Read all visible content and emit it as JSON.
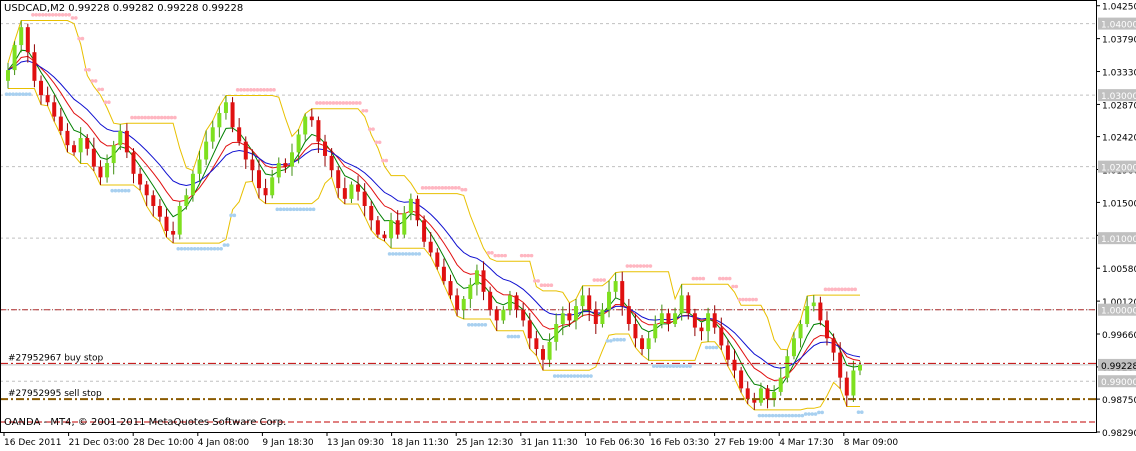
{
  "window": {
    "symbol_header": "USDCAD,M2  0.99228 0.99282 0.99228 0.99228",
    "broker_footer": "OANDA - MT4, © 2001-2011 MetaQuotes Software Corp."
  },
  "colors": {
    "background": "#ffffff",
    "grid": "#c0c0c0",
    "bull_candle": "#7ee01f",
    "bear_candle": "#e01010",
    "ma_fast": "#008000",
    "ma_mid": "#e01010",
    "ma_slow": "#1010d0",
    "channel": "#e8c000",
    "stop_upper_dots": "#ffb6c1",
    "stop_lower_dots": "#a8d0f0",
    "level_box": "#c0c0c0",
    "current_price_box": "#c0c0c0"
  },
  "chart_data": {
    "type": "candlestick",
    "ylim": [
      0.9829,
      1.0433
    ],
    "price_axis_ticks": [
      "1.04250",
      "1.03790",
      "1.03330",
      "1.02870",
      "1.02420",
      "1.01960",
      "1.01500",
      "1.01040",
      "1.00580",
      "1.00120",
      "0.99660",
      "0.99200",
      "0.98750",
      "0.98290"
    ],
    "level_labels": [
      {
        "value": 1.04,
        "text": "1.04000"
      },
      {
        "value": 1.03,
        "text": "1.03000"
      },
      {
        "value": 1.02,
        "text": "1.02000"
      },
      {
        "value": 1.01,
        "text": "1.01000"
      },
      {
        "value": 1.0,
        "text": "1.00000"
      },
      {
        "value": 0.99,
        "text": "0.99000"
      }
    ],
    "current_price": {
      "value": 0.99228,
      "text": "0.99228"
    },
    "time_axis_labels": [
      "16 Dec 2011",
      "21 Dec 03:00",
      "28 Dec 10:00",
      "4 Jan 08:00",
      "9 Jan 18:30",
      "13 Jan 09:30",
      "18 Jan 11:30",
      "25 Jan 12:30",
      "31 Jan 11:30",
      "10 Feb 06:30",
      "16 Feb 03:30",
      "27 Feb 19:00",
      "4 Mar 17:30",
      "8 Mar 09:00"
    ],
    "pending_orders": [
      {
        "label": "#27952967 buy stop",
        "price": 0.9925
      },
      {
        "label": "#27952995 sell stop",
        "price": 0.9875
      }
    ],
    "closes": [
      1.0335,
      1.037,
      1.0395,
      1.036,
      1.032,
      1.03,
      1.029,
      1.027,
      1.025,
      1.023,
      1.022,
      1.024,
      1.0225,
      1.02,
      1.0185,
      1.0205,
      1.023,
      1.025,
      1.022,
      1.019,
      1.0175,
      1.016,
      1.0145,
      1.013,
      1.011,
      1.0105,
      1.0145,
      1.016,
      1.019,
      1.021,
      1.0235,
      1.0255,
      1.0275,
      1.029,
      1.0255,
      1.0235,
      1.021,
      1.0195,
      1.017,
      1.016,
      1.0185,
      1.0205,
      1.02,
      1.022,
      1.0245,
      1.027,
      1.0265,
      1.0235,
      1.0215,
      1.0195,
      1.017,
      1.0155,
      1.0175,
      1.0165,
      1.0145,
      1.0125,
      1.0105,
      1.01,
      1.0125,
      1.0105,
      1.0135,
      1.0155,
      1.0125,
      1.0095,
      1.008,
      1.006,
      1.004,
      1.002,
      1.0,
      1.0015,
      1.0035,
      1.0055,
      1.0025,
      1.0,
      0.9985,
      1.0,
      1.002,
      1.0,
      0.9985,
      0.996,
      0.9945,
      0.993,
      0.9955,
      0.998,
      0.9995,
      0.9985,
      1.0005,
      1.002,
      1.0,
      0.998,
      1.0,
      1.0025,
      1.004,
      1.0005,
      0.998,
      0.996,
      0.9945,
      0.996,
      0.998,
      0.9995,
      0.998,
      0.9995,
      1.002,
      0.9995,
      0.9975,
      0.997,
      0.9995,
      0.9975,
      0.995,
      0.993,
      0.9915,
      0.989,
      0.9875,
      0.987,
      0.989,
      0.9875,
      0.9885,
      0.9905,
      0.9935,
      0.996,
      0.998,
      1.0005,
      1.001,
      0.9985,
      0.996,
      0.994,
      0.9905,
      0.988,
      0.9915,
      0.99228
    ]
  }
}
